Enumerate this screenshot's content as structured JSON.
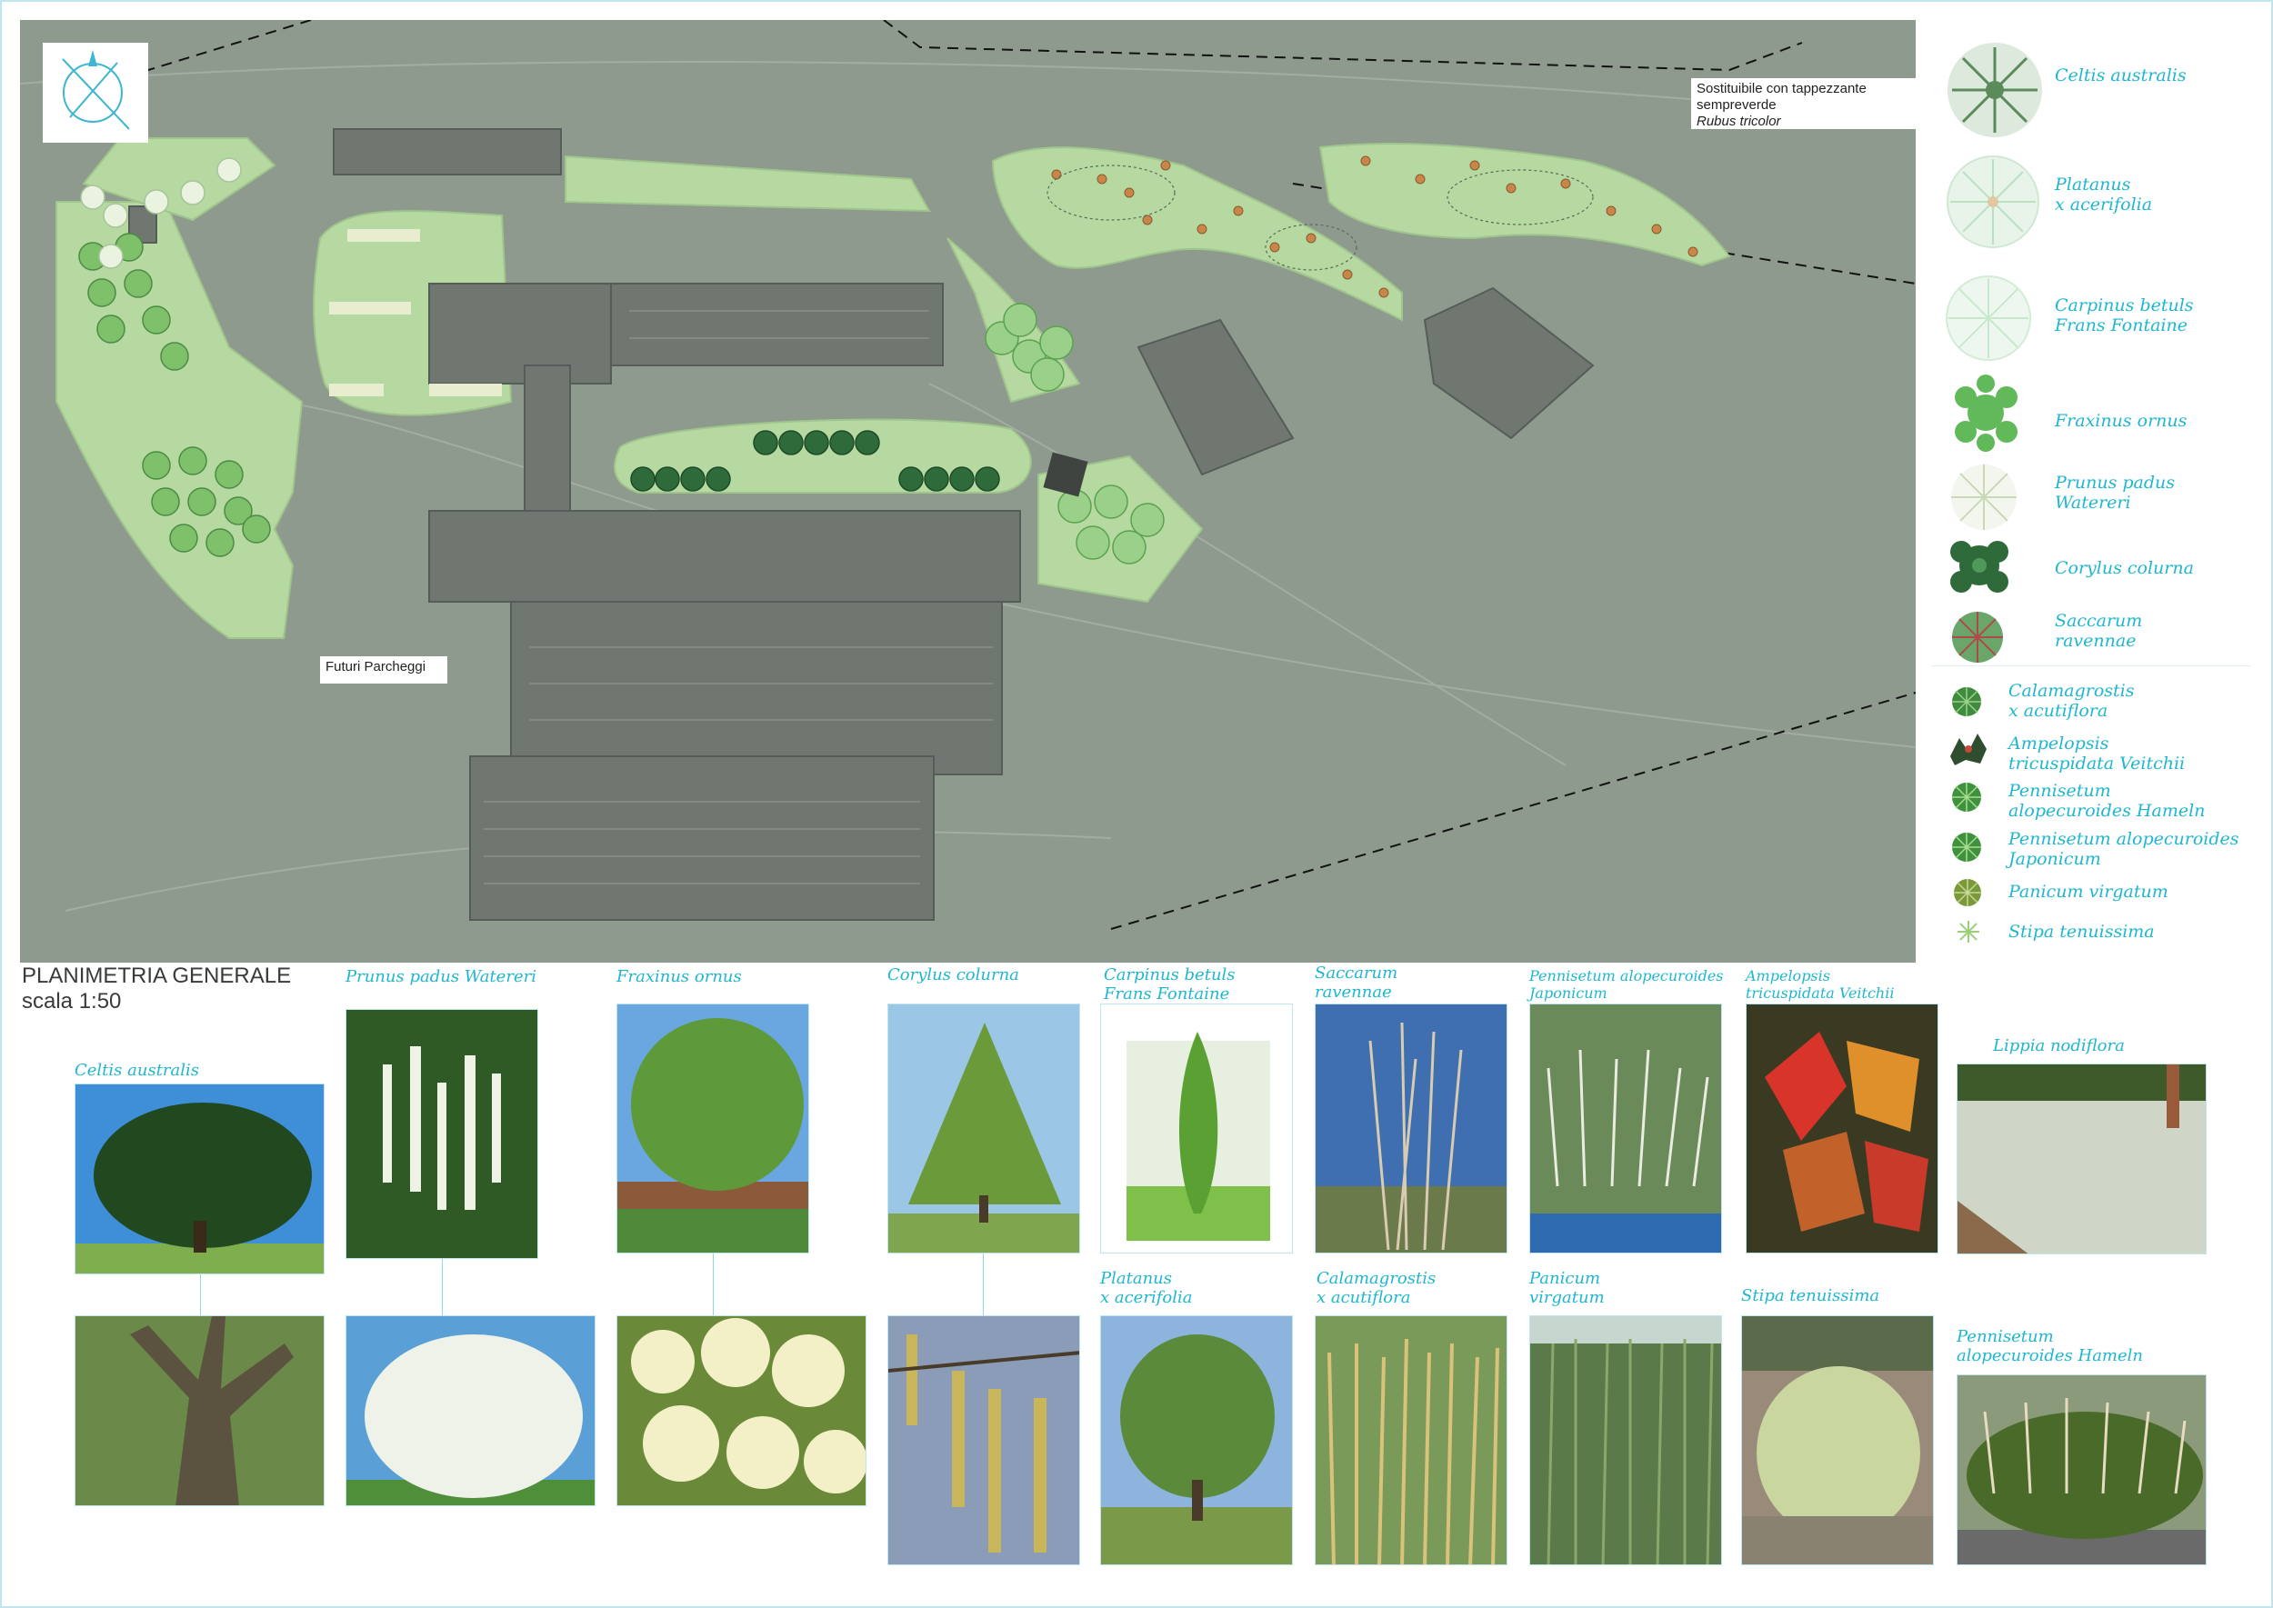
{
  "plan": {
    "notes": {
      "sostituibile_line1": "Sostituibile con tappezzante",
      "sostituibile_line2": "sempreverde",
      "sostituibile_species": "Rubus tricolor",
      "parcheggi": "Futuri Parcheggi"
    },
    "title": "PLANIMETRIA GENERALE",
    "scale": "scala 1:50"
  },
  "legend": {
    "trees": [
      {
        "name": "Celtis australis",
        "color": "#5b8a5b"
      },
      {
        "name": "Platanus\nx acerifolia",
        "color": "#b9e0c0"
      },
      {
        "name": "Carpinus betuls\nFrans Fontaine",
        "color": "#c8e8cc"
      },
      {
        "name": "Fraxinus ornus",
        "color": "#62b95a"
      },
      {
        "name": "Prunus padus\nWatereri",
        "color": "#d5e2c8"
      },
      {
        "name": "Corylus colurna",
        "color": "#2f6b3a"
      },
      {
        "name": "Saccarum\nravennae",
        "color": "#b04a4a"
      }
    ],
    "grasses": [
      {
        "name": "Calamagrostis\nx acutiflora",
        "color": "#3f8b3f"
      },
      {
        "name": "Ampelopsis\ntricuspidata Veitchii",
        "color": "#2f4d2f"
      },
      {
        "name": "Pennisetum\nalopecuroides Hameln",
        "color": "#3e923e"
      },
      {
        "name": "Pennisetum alopecuroides\nJaponicum",
        "color": "#3e923e"
      },
      {
        "name": "Panicum virgatum",
        "color": "#7a9a3a"
      },
      {
        "name": "Stipa tenuissima",
        "color": "#9ccf7a"
      }
    ]
  },
  "photos": {
    "labels": {
      "celtis": "Celtis australis",
      "prunus": "Prunus padus Watereri",
      "fraxinus": "Fraxinus ornus",
      "corylus": "Corylus colurna",
      "carpinus": "Carpinus betuls\nFrans Fontaine",
      "saccarum": "Saccarum\nravennae",
      "penn_jap": "Pennisetum alopecuroides\nJaponicum",
      "ampelopsis": "Ampelopsis\ntricuspidata Veitchii",
      "lippia": "Lippia nodiflora",
      "platanus": "Platanus\nx acerifolia",
      "calamagrostis": "Calamagrostis\nx acutiflora",
      "panicum": "Panicum\nvirgatum",
      "stipa": "Stipa tenuissima",
      "penn_ham": "Pennisetum\nalopecuroides Hameln"
    }
  },
  "colors": {
    "accent": "#1fb7cf",
    "plan_bg": "#8e9a8e",
    "lawn": "#b5d9a0",
    "building": "#6f7770"
  }
}
